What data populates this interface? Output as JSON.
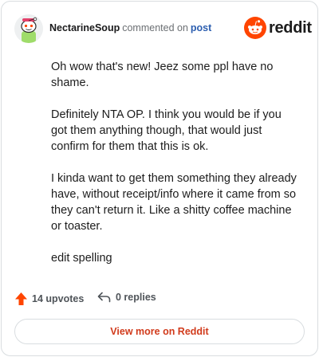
{
  "header": {
    "username": "NectarineSoup",
    "commented_text": "commented on",
    "post_link": "post",
    "brand_wordmark": "reddit"
  },
  "comment": {
    "paragraphs": [
      "Oh wow that's new! Jeez some ppl have no shame.",
      "Definitely NTA OP. I think you would be if you got them anything though, that would just confirm for them that this is ok.",
      "I kinda want to get them something they already have, without receipt/info where it came from so they can't return it. Like a shitty coffee machine or toaster.",
      "edit spelling"
    ]
  },
  "footer": {
    "upvotes_label": "14 upvotes",
    "replies_label": "0 replies"
  },
  "view_more_label": "View more on Reddit",
  "colors": {
    "brand_orange": "#ff4500",
    "link_blue": "#2d5fb0",
    "view_more_red": "#d13b1c"
  },
  "icons": {
    "upvote": "upvote-arrow-icon",
    "reply": "reply-arrow-icon",
    "brand": "reddit-snoo-icon"
  }
}
